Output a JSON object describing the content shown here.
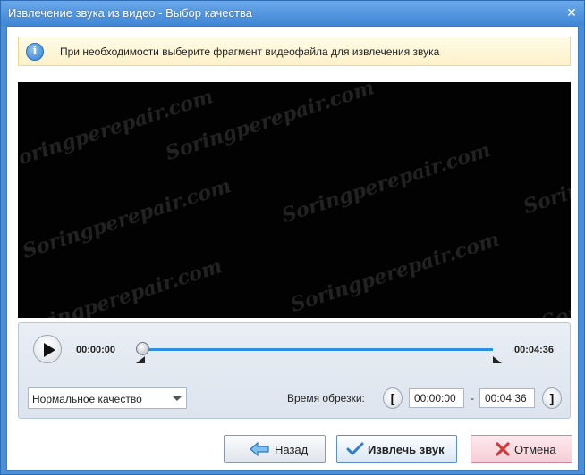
{
  "window": {
    "title": "Извлечение звука из видео - Выбор качества",
    "close_glyph": "✕"
  },
  "info": {
    "icon": "info-icon",
    "icon_glyph": "i",
    "text": "При необходимости выберите фрагмент видеофайла для извлечения звука"
  },
  "watermark": "Soringperepair.com",
  "player": {
    "time_start": "00:00:00",
    "time_end": "00:04:36",
    "progress_fraction": 0,
    "accent": "#2f8fe6"
  },
  "quality": {
    "selected": "Нормальное качество"
  },
  "trim": {
    "label": "Время обрезки:",
    "start": "00:00:00",
    "end": "00:04:36",
    "separator": "-",
    "start_bracket": "[",
    "end_bracket": "]"
  },
  "buttons": {
    "back_label": "Назад",
    "extract_label": "Извлечь звук",
    "cancel_label": "Отмена"
  }
}
